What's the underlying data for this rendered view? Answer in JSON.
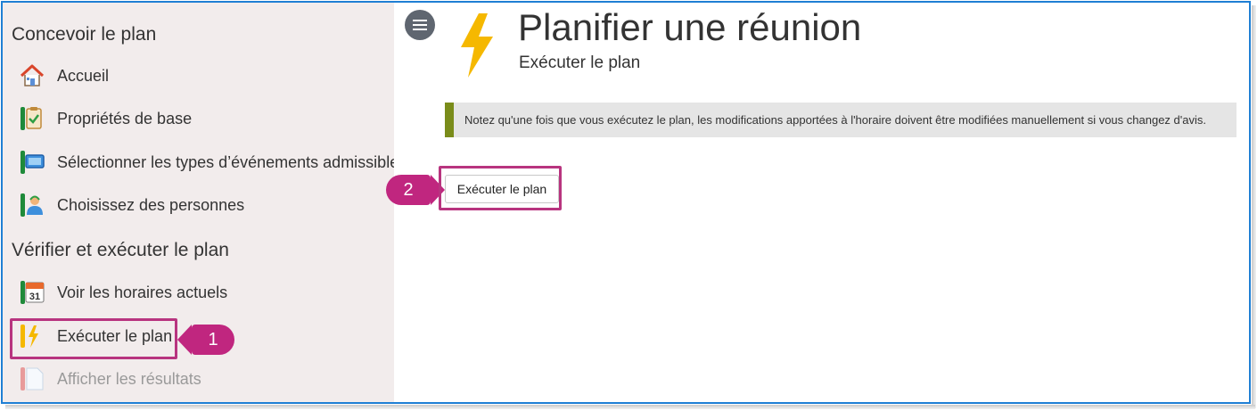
{
  "sidebar": {
    "section_design": "Concevoir le plan",
    "section_verify": "Vérifier et exécuter le plan",
    "items": [
      {
        "label": "Accueil",
        "icon": "home-icon"
      },
      {
        "label": "Propriétés de base",
        "icon": "clipboard-check-icon"
      },
      {
        "label": "Sélectionner les types d’événements admissibles",
        "icon": "event-types-icon"
      },
      {
        "label": "Choisissez des personnes",
        "icon": "person-icon"
      },
      {
        "label": "Voir les horaires actuels",
        "icon": "calendar-icon",
        "calendar_day": "31"
      },
      {
        "label": "Exécuter le plan",
        "icon": "lightning-icon",
        "selected": true
      },
      {
        "label": "Afficher les résultats",
        "icon": "document-icon",
        "disabled": true
      }
    ]
  },
  "header": {
    "title": "Planifier une réunion",
    "subtitle": "Exécuter le plan"
  },
  "note": "Notez qu'une fois que vous exécutez le plan, les modifications apportées à l'horaire doivent être modifiées manuellement si vous changez d'avis.",
  "execute_button": "Exécuter le plan",
  "callouts": {
    "step1": "1",
    "step2": "2"
  },
  "colors": {
    "accent_magenta": "#c0267f",
    "note_bar": "#7a8c1a",
    "sidebar_bg": "#f2ecec",
    "frame_border": "#1f7fd4",
    "lightning": "#f5b800"
  }
}
